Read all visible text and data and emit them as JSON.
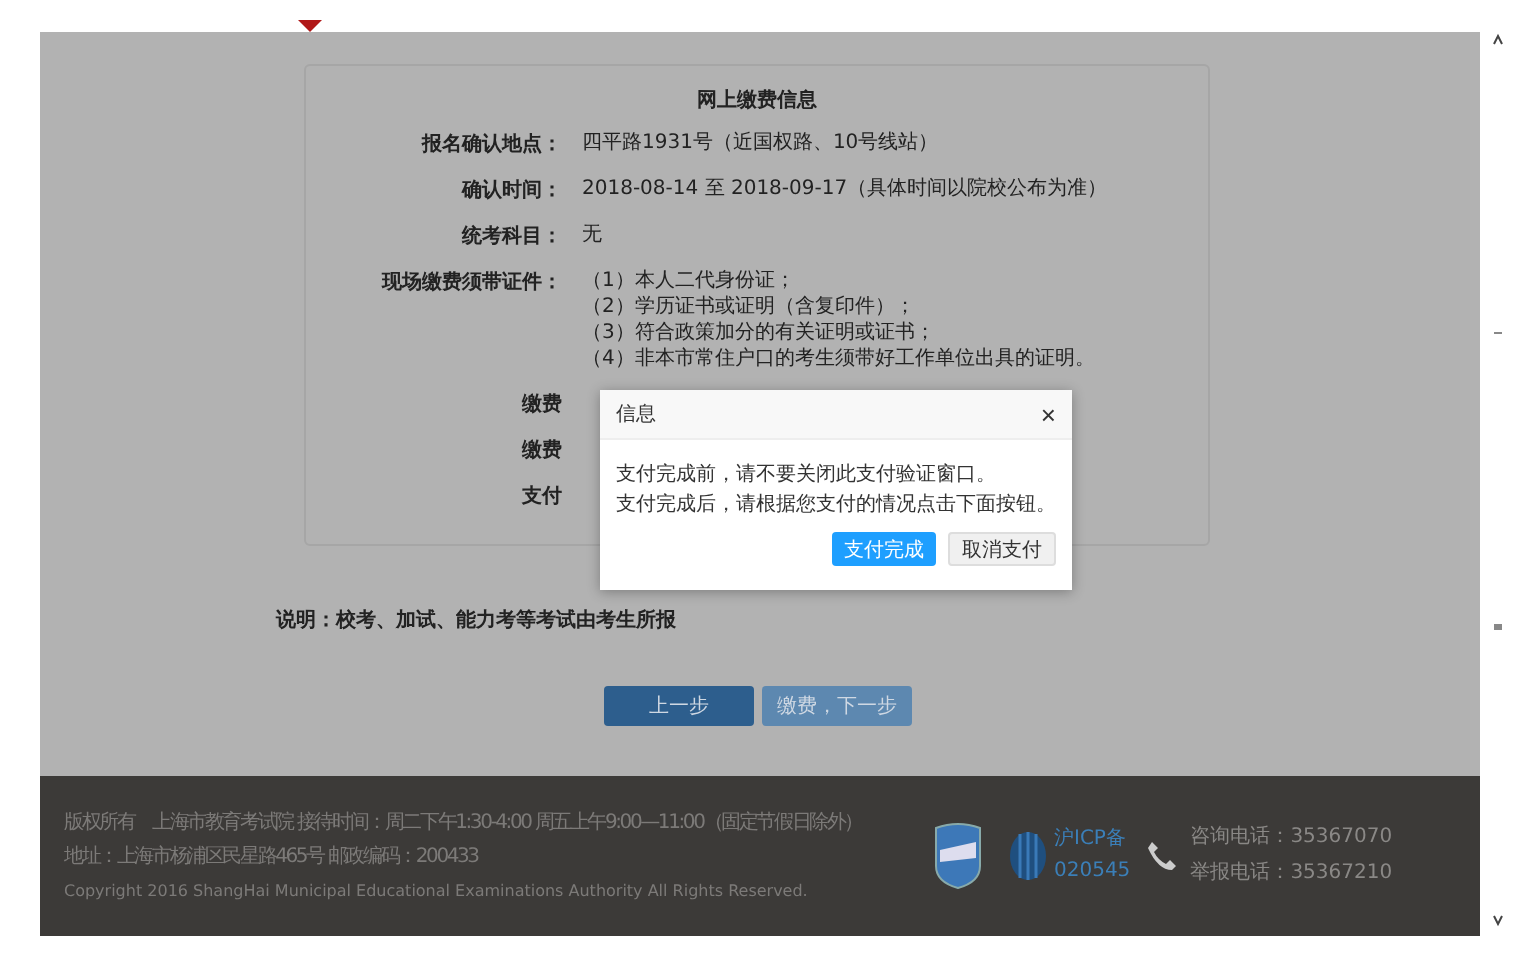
{
  "card": {
    "title": "网上缴费信息",
    "rows": [
      {
        "label": "报名确认地点：",
        "lines": [
          "四平路1931号（近国权路、10号线站）"
        ]
      },
      {
        "label": "确认时间：",
        "lines": [
          "2018-08-14 至 2018-09-17（具体时间以院校公布为准）"
        ]
      },
      {
        "label": "统考科目：",
        "lines": [
          "无"
        ]
      },
      {
        "label": "现场缴费须带证件：",
        "lines": [
          "（1）本人二代身份证；",
          "（2）学历证书或证明（含复印件）；",
          "（3）符合政策加分的有关证明或证书；",
          "（4）非本市常住户口的考生须带好工作单位出具的证明。"
        ]
      },
      {
        "label": "缴费",
        "lines": []
      },
      {
        "label": "缴费",
        "lines": []
      },
      {
        "label": "支付",
        "lines": []
      }
    ]
  },
  "note": "说明：校考、加试、能力考等考试由考生所报",
  "steps": [
    {
      "label": "上一步",
      "kind": "primary"
    },
    {
      "label": "缴费，下一步",
      "kind": "secondary"
    }
  ],
  "dialog": {
    "title": "信息",
    "close": "×",
    "lines": [
      "支付完成前，请不要关闭此支付验证窗口。",
      "支付完成后，请根据您支付的情况点击下面按钮。"
    ],
    "buttons": [
      {
        "label": "支付完成",
        "kind": "primary"
      },
      {
        "label": "取消支付",
        "kind": "secondary"
      }
    ]
  },
  "footer": {
    "lines": [
      "版权所有　上海市教育考试院 接待时间：周二下午1:30-4:00 周五上午9:00—11:00（固定节假日除外）",
      "地址：上海市杨浦区民星路465号 邮政编码：200433",
      "Copyright 2016 ShangHai Municipal Educational Examinations Authority All Rights Reserved."
    ],
    "icp": [
      "沪ICP备",
      "020545"
    ],
    "phones": [
      "咨询电话：35367070",
      "举报电话：35367210"
    ]
  }
}
